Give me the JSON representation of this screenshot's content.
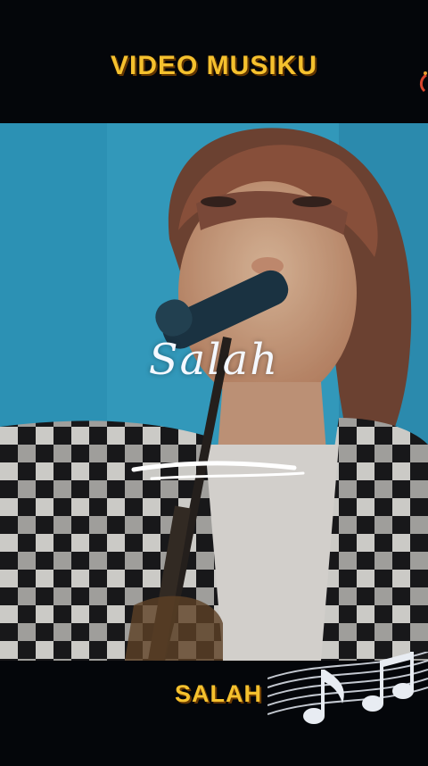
{
  "header": {
    "title": "VIDEO MUSIKU"
  },
  "video": {
    "caption": "Salah"
  },
  "footer": {
    "song_title": "SALAH"
  },
  "colors": {
    "title_gold": "#f5c12e",
    "backdrop_blue": "#3cb2d8",
    "bar_black": "#04060a"
  },
  "icons": [
    "music-notes-icon",
    "brand-mark-icon"
  ]
}
